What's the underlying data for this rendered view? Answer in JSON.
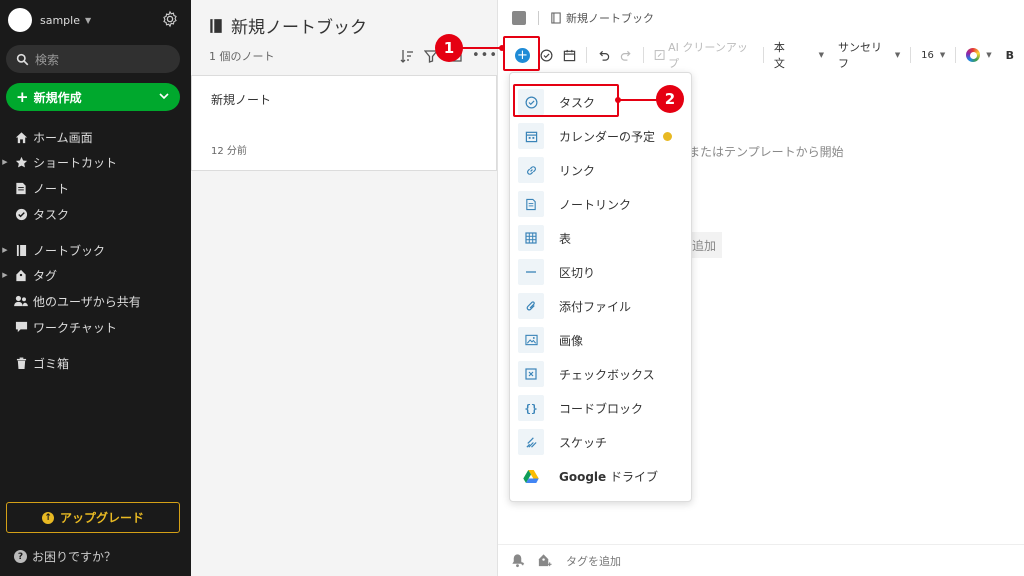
{
  "sidebar": {
    "account_name": "sample",
    "search_placeholder": "検索",
    "new_label": "新規作成",
    "nav": [
      {
        "label": "ホーム画面"
      },
      {
        "label": "ショートカット"
      },
      {
        "label": "ノート"
      },
      {
        "label": "タスク"
      },
      {
        "label": "ノートブック"
      },
      {
        "label": "タグ"
      },
      {
        "label": "他のユーザから共有"
      },
      {
        "label": "ワークチャット"
      },
      {
        "label": "ゴミ箱"
      }
    ],
    "upgrade_label": "アップグレード",
    "help_label": "お困りですか？"
  },
  "notelist": {
    "notebook_title": "新規ノートブック",
    "note_count": "1 個のノート",
    "note": {
      "title": "新規ノート",
      "time": "12 分前"
    }
  },
  "editor": {
    "breadcrumb": "新規ノートブック",
    "toolbar": {
      "ai_label": "AI クリーンアップ",
      "style_label": "本文",
      "font_label": "サンセリフ",
      "size_label": "16",
      "bold_label": "B"
    },
    "hint_text": "またはテンプレートから開始",
    "add_hint": "追加",
    "tag_label": "タグを追加"
  },
  "insert_menu": {
    "items": [
      {
        "label": "タスク",
        "icon": "check-circle-icon"
      },
      {
        "label": "カレンダーの予定",
        "icon": "calendar-icon"
      },
      {
        "label": "リンク",
        "icon": "link-icon"
      },
      {
        "label": "ノートリンク",
        "icon": "note-link-icon"
      },
      {
        "label": "表",
        "icon": "table-icon"
      },
      {
        "label": "区切り",
        "icon": "divider-icon"
      },
      {
        "label": "添付ファイル",
        "icon": "paperclip-icon"
      },
      {
        "label": "画像",
        "icon": "image-icon"
      },
      {
        "label": "チェックボックス",
        "icon": "checkbox-icon"
      },
      {
        "label": "コードブロック",
        "icon": "code-block-icon"
      },
      {
        "label": "スケッチ",
        "icon": "sketch-icon"
      },
      {
        "label": "ドライブ",
        "brand": "Google",
        "icon": "google-drive-icon"
      }
    ]
  },
  "annotations": {
    "step1": "1",
    "step2": "2"
  },
  "colors": {
    "sidebar_bg": "#1a1a1a",
    "accent_green": "#00a82d",
    "upgrade_gold": "#e8b923",
    "insert_blue": "#1f8bd6",
    "annotation_red": "#e50012"
  }
}
